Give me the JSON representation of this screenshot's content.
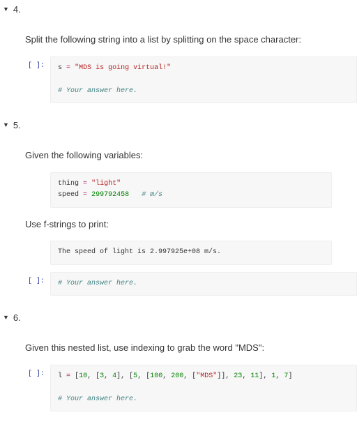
{
  "sections": [
    {
      "num": "4.",
      "prose1": "Split the following string into a list by splitting on the space character:",
      "code1": {
        "v1": "s",
        "op1": "=",
        "s1": "\"MDS is going virtual!\"",
        "c1": "# Your answer here."
      }
    },
    {
      "num": "5.",
      "prose1": "Given the following variables:",
      "code1": {
        "v1": "thing",
        "op1": "=",
        "s1": "\"light\"",
        "v2": "speed",
        "op2": "=",
        "n1": "299792458",
        "c1": "# m/s"
      },
      "prose2": "Use f-strings to print:",
      "code2": {
        "raw": "The speed of light is 2.997925e+08 m/s."
      },
      "code3": {
        "c1": "# Your answer here."
      }
    },
    {
      "num": "6.",
      "prose1": "Given this nested list, use indexing to grab the word \"MDS\":",
      "code1": {
        "v1": "l",
        "op1": "=",
        "p1": "[",
        "n1": "10",
        "p2": ", [",
        "n2": "3",
        "p3": ", ",
        "n3": "4",
        "p4": "], [",
        "n4": "5",
        "p5": ", [",
        "n5": "100",
        "p6": ", ",
        "n6": "200",
        "p7": ", [",
        "s1": "\"MDS\"",
        "p8": "]], ",
        "n7": "23",
        "p9": ", ",
        "n8": "11",
        "p10": "], ",
        "n9": "1",
        "p11": ", ",
        "n10": "7",
        "p12": "]",
        "c1": "# Your answer here."
      }
    }
  ],
  "prompt_label": "[ ]:"
}
